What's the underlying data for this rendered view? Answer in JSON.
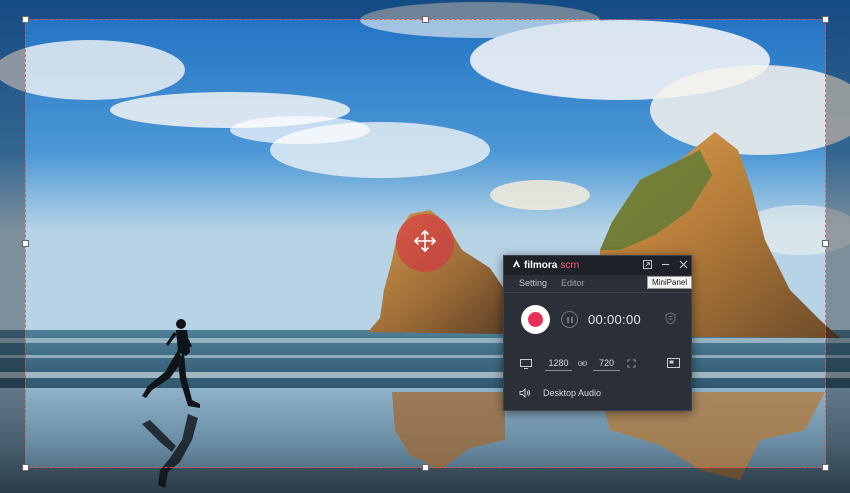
{
  "recorder": {
    "brand": "filmora",
    "brand_suffix": "scrn",
    "tabs": [
      {
        "label": "Setting"
      },
      {
        "label": "Editor"
      }
    ],
    "tooltip": "MiniPanel",
    "timer": "00:00:00",
    "width_value": "1280",
    "height_value": "720",
    "audio_label": "Desktop Audio"
  },
  "icons": {
    "minipanel": "minipanel-icon",
    "minimize": "minimize-icon",
    "close": "close-icon",
    "record": "record-icon",
    "pause": "pause-icon",
    "shield": "shield-icon",
    "monitor": "monitor-icon",
    "link": "link-icon",
    "fullscreen": "fullscreen-icon",
    "screen_select": "screen-select-icon",
    "speaker": "speaker-icon",
    "move": "move-icon"
  },
  "colors": {
    "record_red": "#e8315a",
    "brand_accent": "#ff5a73",
    "panel_bg": "#2b2f37",
    "region_border": "#e65050"
  }
}
